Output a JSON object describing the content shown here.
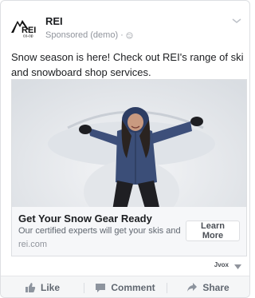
{
  "post": {
    "page_name": "REI",
    "sponsored_label": "Sponsored (demo)",
    "separator": "·",
    "text": "Snow season is here! Check out REI's range of ski and snowboard shop services."
  },
  "logo": {
    "word": "REI",
    "subword": "co-op",
    "icon": "rei-logo-icon"
  },
  "link": {
    "headline": "Get Your Snow Gear Ready",
    "description": "Our certified experts will get your skis and ...",
    "domain": "rei.com",
    "cta_label": "Learn More"
  },
  "footer": {
    "mark": "Jvox"
  },
  "actions": [
    {
      "label": "Like",
      "icon": "thumbs-up-icon"
    },
    {
      "label": "Comment",
      "icon": "comment-icon"
    },
    {
      "label": "Share",
      "icon": "share-icon"
    }
  ],
  "colors": {
    "text": "#1c1e21",
    "muted": "#90949c",
    "border": "#dddfe2",
    "link_bg": "#f6f7f9",
    "jacket": "#3d4f7a"
  }
}
